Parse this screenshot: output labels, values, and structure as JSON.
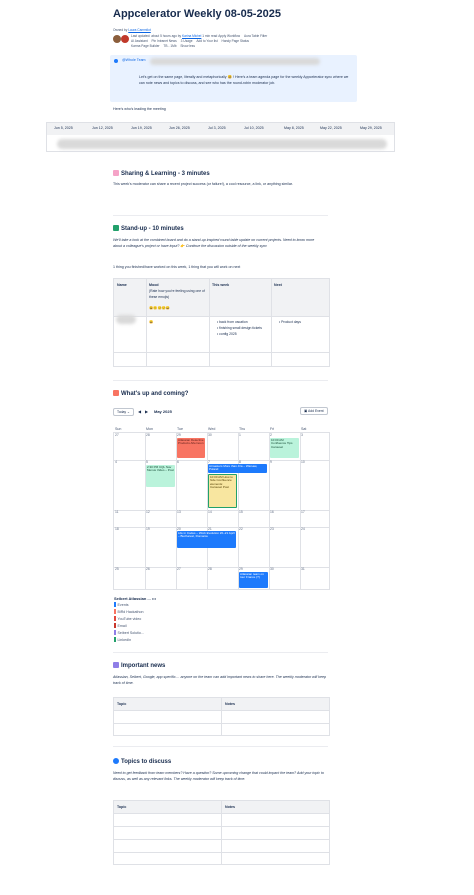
{
  "page": {
    "title": "Appcelerator Weekly 08-05-2025",
    "owned_by": "Owned by",
    "owner": "Laura Cammilot",
    "last_updated": "Last updated: about 5 hours ago by",
    "updated_by": "Karina Michel",
    "read_time": "1 min read",
    "meta_items_row1": [
      "Apply Workflow",
      "Aura Table Filter"
    ],
    "meta_items_row2": [
      "AI Assistant",
      "Pin Intranet News",
      "3 Usage",
      "Add to Your list",
      "Handy Page Status"
    ],
    "meta_items_row3": [
      "Karma Page Builder",
      "TB - 1Mb",
      "Show less"
    ]
  },
  "info": {
    "mention": "@Whole Team",
    "text": "Let's get on the same page, literally and metaphorically 😃 ! Here's a team agenda page for the weekly Appcelerator sync where we can note news and topics to discuss, and see who has the round-robin moderator job."
  },
  "leading_intro": "Here's who's leading the meeting",
  "moderator_dates": [
    "Jun 5, 2025",
    "Jun 12, 2025",
    "Jun 19, 2025",
    "Jun 26, 2025",
    "Jul 3, 2025",
    "Jul 10, 2025",
    "May 8, 2025",
    "May 22, 2025",
    "May 29, 2025"
  ],
  "sharing": {
    "heading": "Sharing & Learning - 3 minutes",
    "text": "This week's moderator can share a recent project success (or failure!), a cool resource, a link, or anything similar."
  },
  "standup": {
    "heading": "Stand-up - 10 minutes",
    "text": "We'll take a look at the combined board and do a stand-up inspired round table update on current projects. Need to know more about a colleague's project or have input? 👉 Continue the discussion outside of the weekly sync",
    "subtext": "1 thing you finished/have worked on this week, 1 thing that you will work on next",
    "columns": [
      "Name",
      "Mood",
      "This week",
      "Next"
    ],
    "mood_hint": "(Rate how you're feeling using one of these emojis)",
    "mood_emojis": "😩😕😐🙂😀",
    "mood_value": "😀",
    "this_week": [
      "back from vacation",
      "finishing small design tickets",
      "config 2025"
    ],
    "next": [
      "Product days"
    ]
  },
  "upcoming": {
    "heading": "What's up and coming?",
    "today_label": "Today",
    "month_label": "May 2025",
    "add_event_label": "Add Event",
    "weekdays": [
      "Sun",
      "Mon",
      "Tue",
      "Wed",
      "Thu",
      "Fri",
      "Sat"
    ],
    "weeks": [
      [
        "27",
        "28",
        "29",
        "30",
        "1",
        "2",
        "3"
      ],
      [
        "4",
        "5",
        "6",
        "7",
        "8",
        "9",
        "10"
      ],
      [
        "11",
        "12",
        "13",
        "14",
        "15",
        "16",
        "17"
      ],
      [
        "18",
        "19",
        "20",
        "21",
        "22",
        "23",
        "24"
      ],
      [
        "25",
        "26",
        "27",
        "28",
        "29",
        "30",
        "31"
      ]
    ],
    "events": {
      "atlassian_detective": "Atlassian Detective Products Afternoon",
      "confluence_tips": "10:00 AM Confluence Tips Carousel",
      "cql_nav_menus": "2:30 PM CQL Nav Menus Video – Post",
      "atmasters": "Atmasters More than Jira – Warsaw, Poland",
      "confluence_elements": "10:00 AM How to hide Confluence elements: Carousel Post",
      "life_in_codes": "Life in Codes – Work Evolution 20–21 April – Bucharest, Romania",
      "atlassian_team_tour": "Atlassian team on tour France (?)"
    },
    "colors": {
      "red": "#f87462",
      "green": "#baf3db",
      "blue": "#1d7afc",
      "yellow": "#f8e6a0"
    },
    "legend_title": "Seibert Atlassian ...",
    "legend": [
      {
        "label": "Events",
        "color": "#1d7afc"
      },
      {
        "label": "BiRd Hackathon",
        "color": "#f87462"
      },
      {
        "label": "YouTube video",
        "color": "#e2483d"
      },
      {
        "label": "Email",
        "color": "#c9372c"
      },
      {
        "label": "Seibert Solutio...",
        "color": "#8f7ee7"
      },
      {
        "label": "LinkedIn",
        "color": "#22a06b"
      }
    ]
  },
  "news": {
    "heading": "Important news",
    "text": "Atlassian, Seibert, Google, app specific.... anyone on the team can add important news to share here. The weekly moderator will keep track of time.",
    "columns": [
      "Topic",
      "Notes"
    ]
  },
  "topics": {
    "heading": "Topics to discuss",
    "text": "Need to get feedback from team members? Have a question? Some upcoming change that could impact the team? Add your topic to discuss, as well as any relevant links. The weekly moderator will keep track of time.",
    "columns": [
      "Topic",
      "Notes"
    ]
  }
}
